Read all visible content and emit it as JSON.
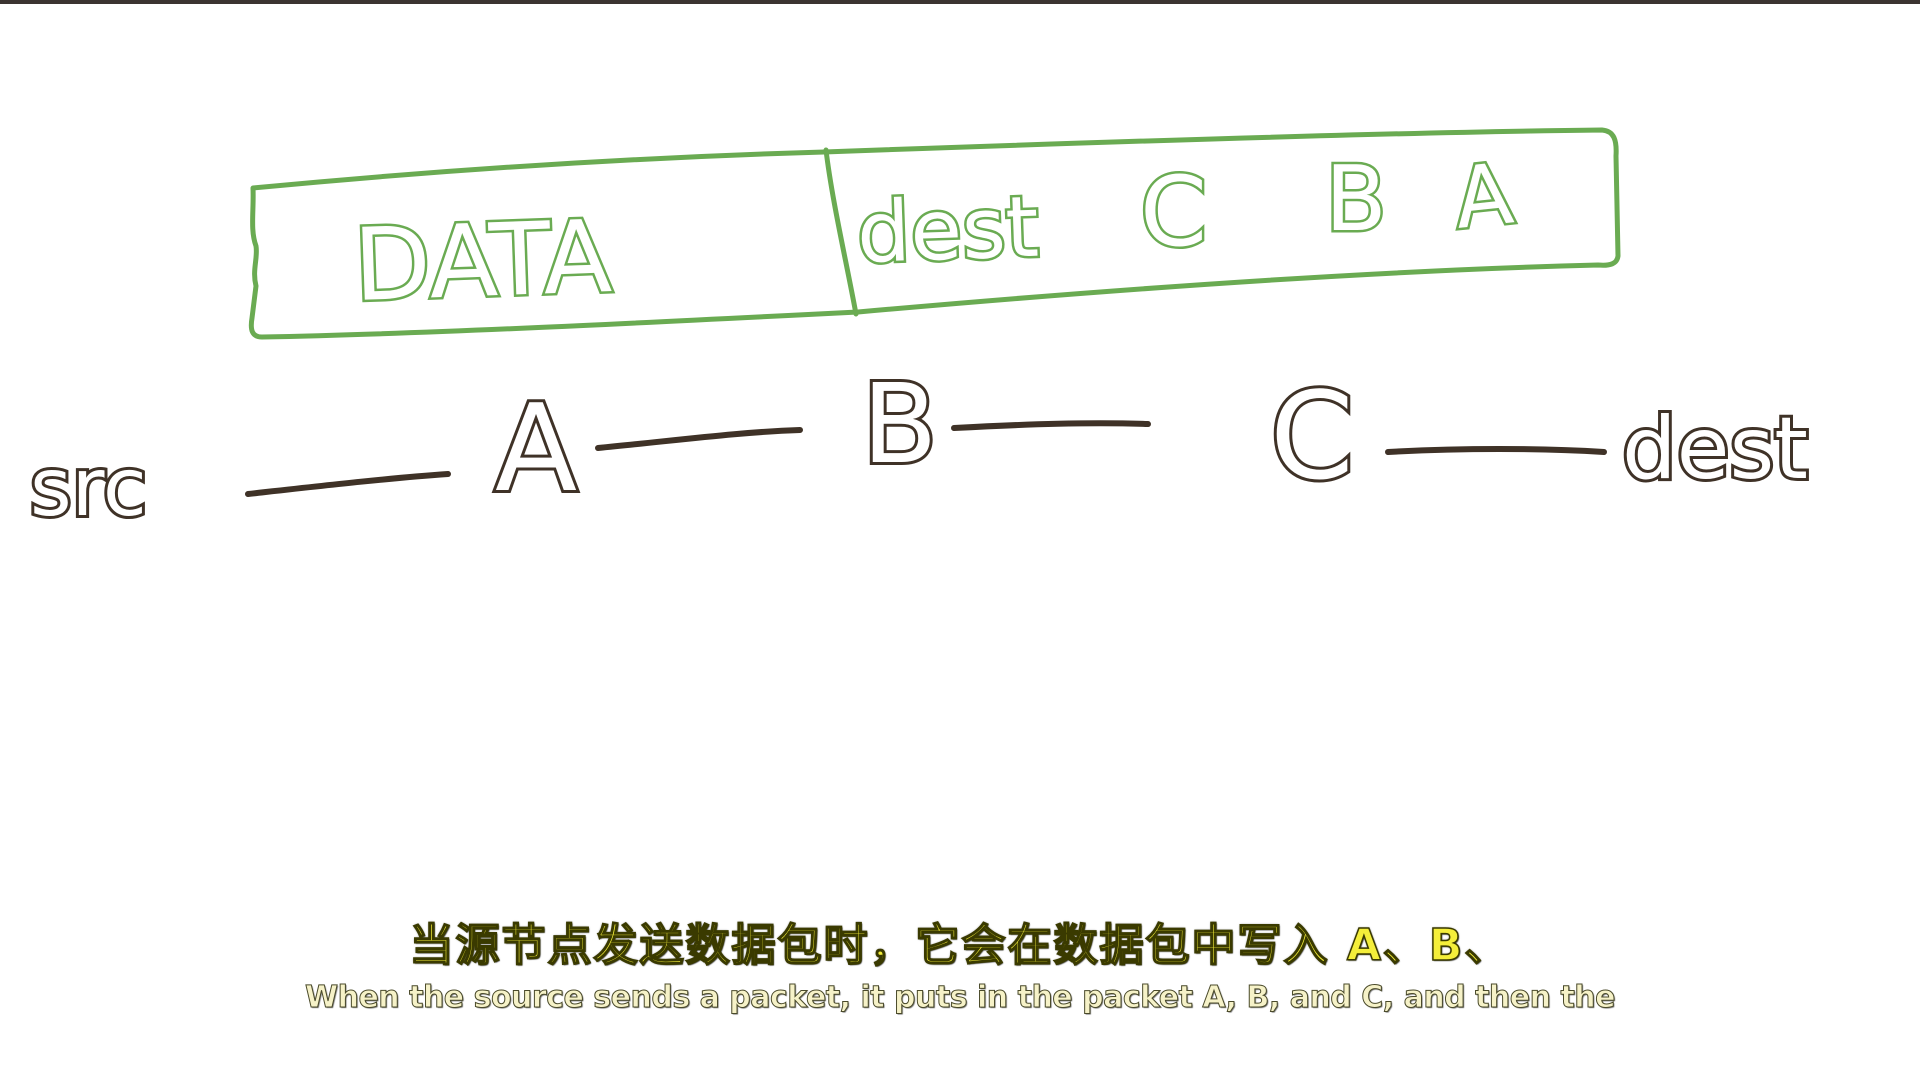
{
  "packet": {
    "data_label": "DATA",
    "header_labels": [
      "dest",
      "C",
      "B",
      "A"
    ]
  },
  "path": {
    "nodes": [
      "src",
      "A",
      "B",
      "C",
      "dest"
    ]
  },
  "subtitles": {
    "zh": "当源节点发送数据包时，它会在数据包中写入 A、B、",
    "en": "When the source sends a packet, it puts in the packet A, B, and C, and then the"
  },
  "colors": {
    "packet_ink": "#6aab52",
    "path_ink": "#3f3227",
    "subtitle_zh": "#f4ee3a",
    "subtitle_en": "#f6f2c8"
  }
}
